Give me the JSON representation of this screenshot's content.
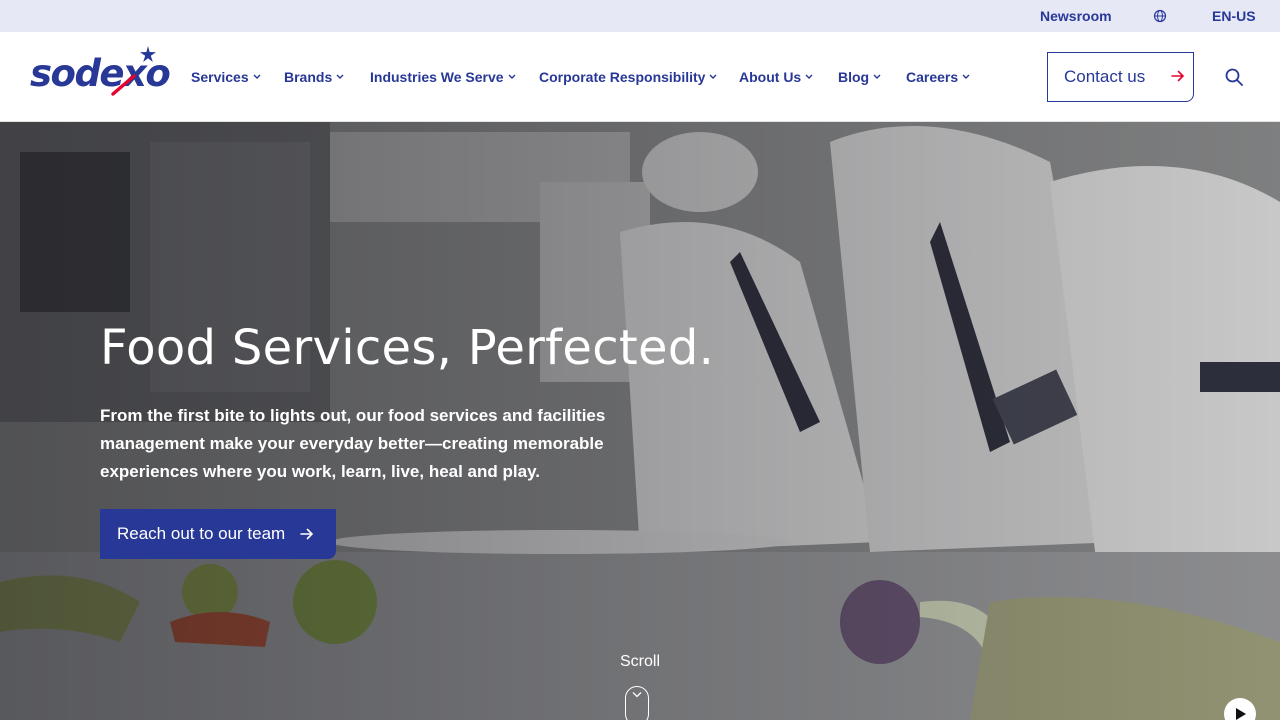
{
  "utility_bar": {
    "newsroom_label": "Newsroom",
    "globe_icon": "globe-icon",
    "language": "EN-US"
  },
  "header": {
    "logo_text": "sodexo",
    "nav": [
      {
        "label": "Services"
      },
      {
        "label": "Brands"
      },
      {
        "label": "Industries We Serve"
      },
      {
        "label": "Corporate Responsibility"
      },
      {
        "label": "About Us"
      },
      {
        "label": "Blog"
      },
      {
        "label": "Careers"
      }
    ],
    "contact_label": "Contact us",
    "search_icon": "search-icon"
  },
  "hero": {
    "title": "Food Services, Perfected.",
    "subtitle": "From the first bite to lights out, our food services and facilities management make your everyday better—creating memorable experiences where you work, learn, live, heal and play.",
    "cta_label": "Reach out to our team",
    "scroll_label": "Scroll"
  },
  "colors": {
    "brand_blue": "#283897",
    "accent_red": "#e4032e",
    "utility_bg": "#e6e8f6"
  }
}
